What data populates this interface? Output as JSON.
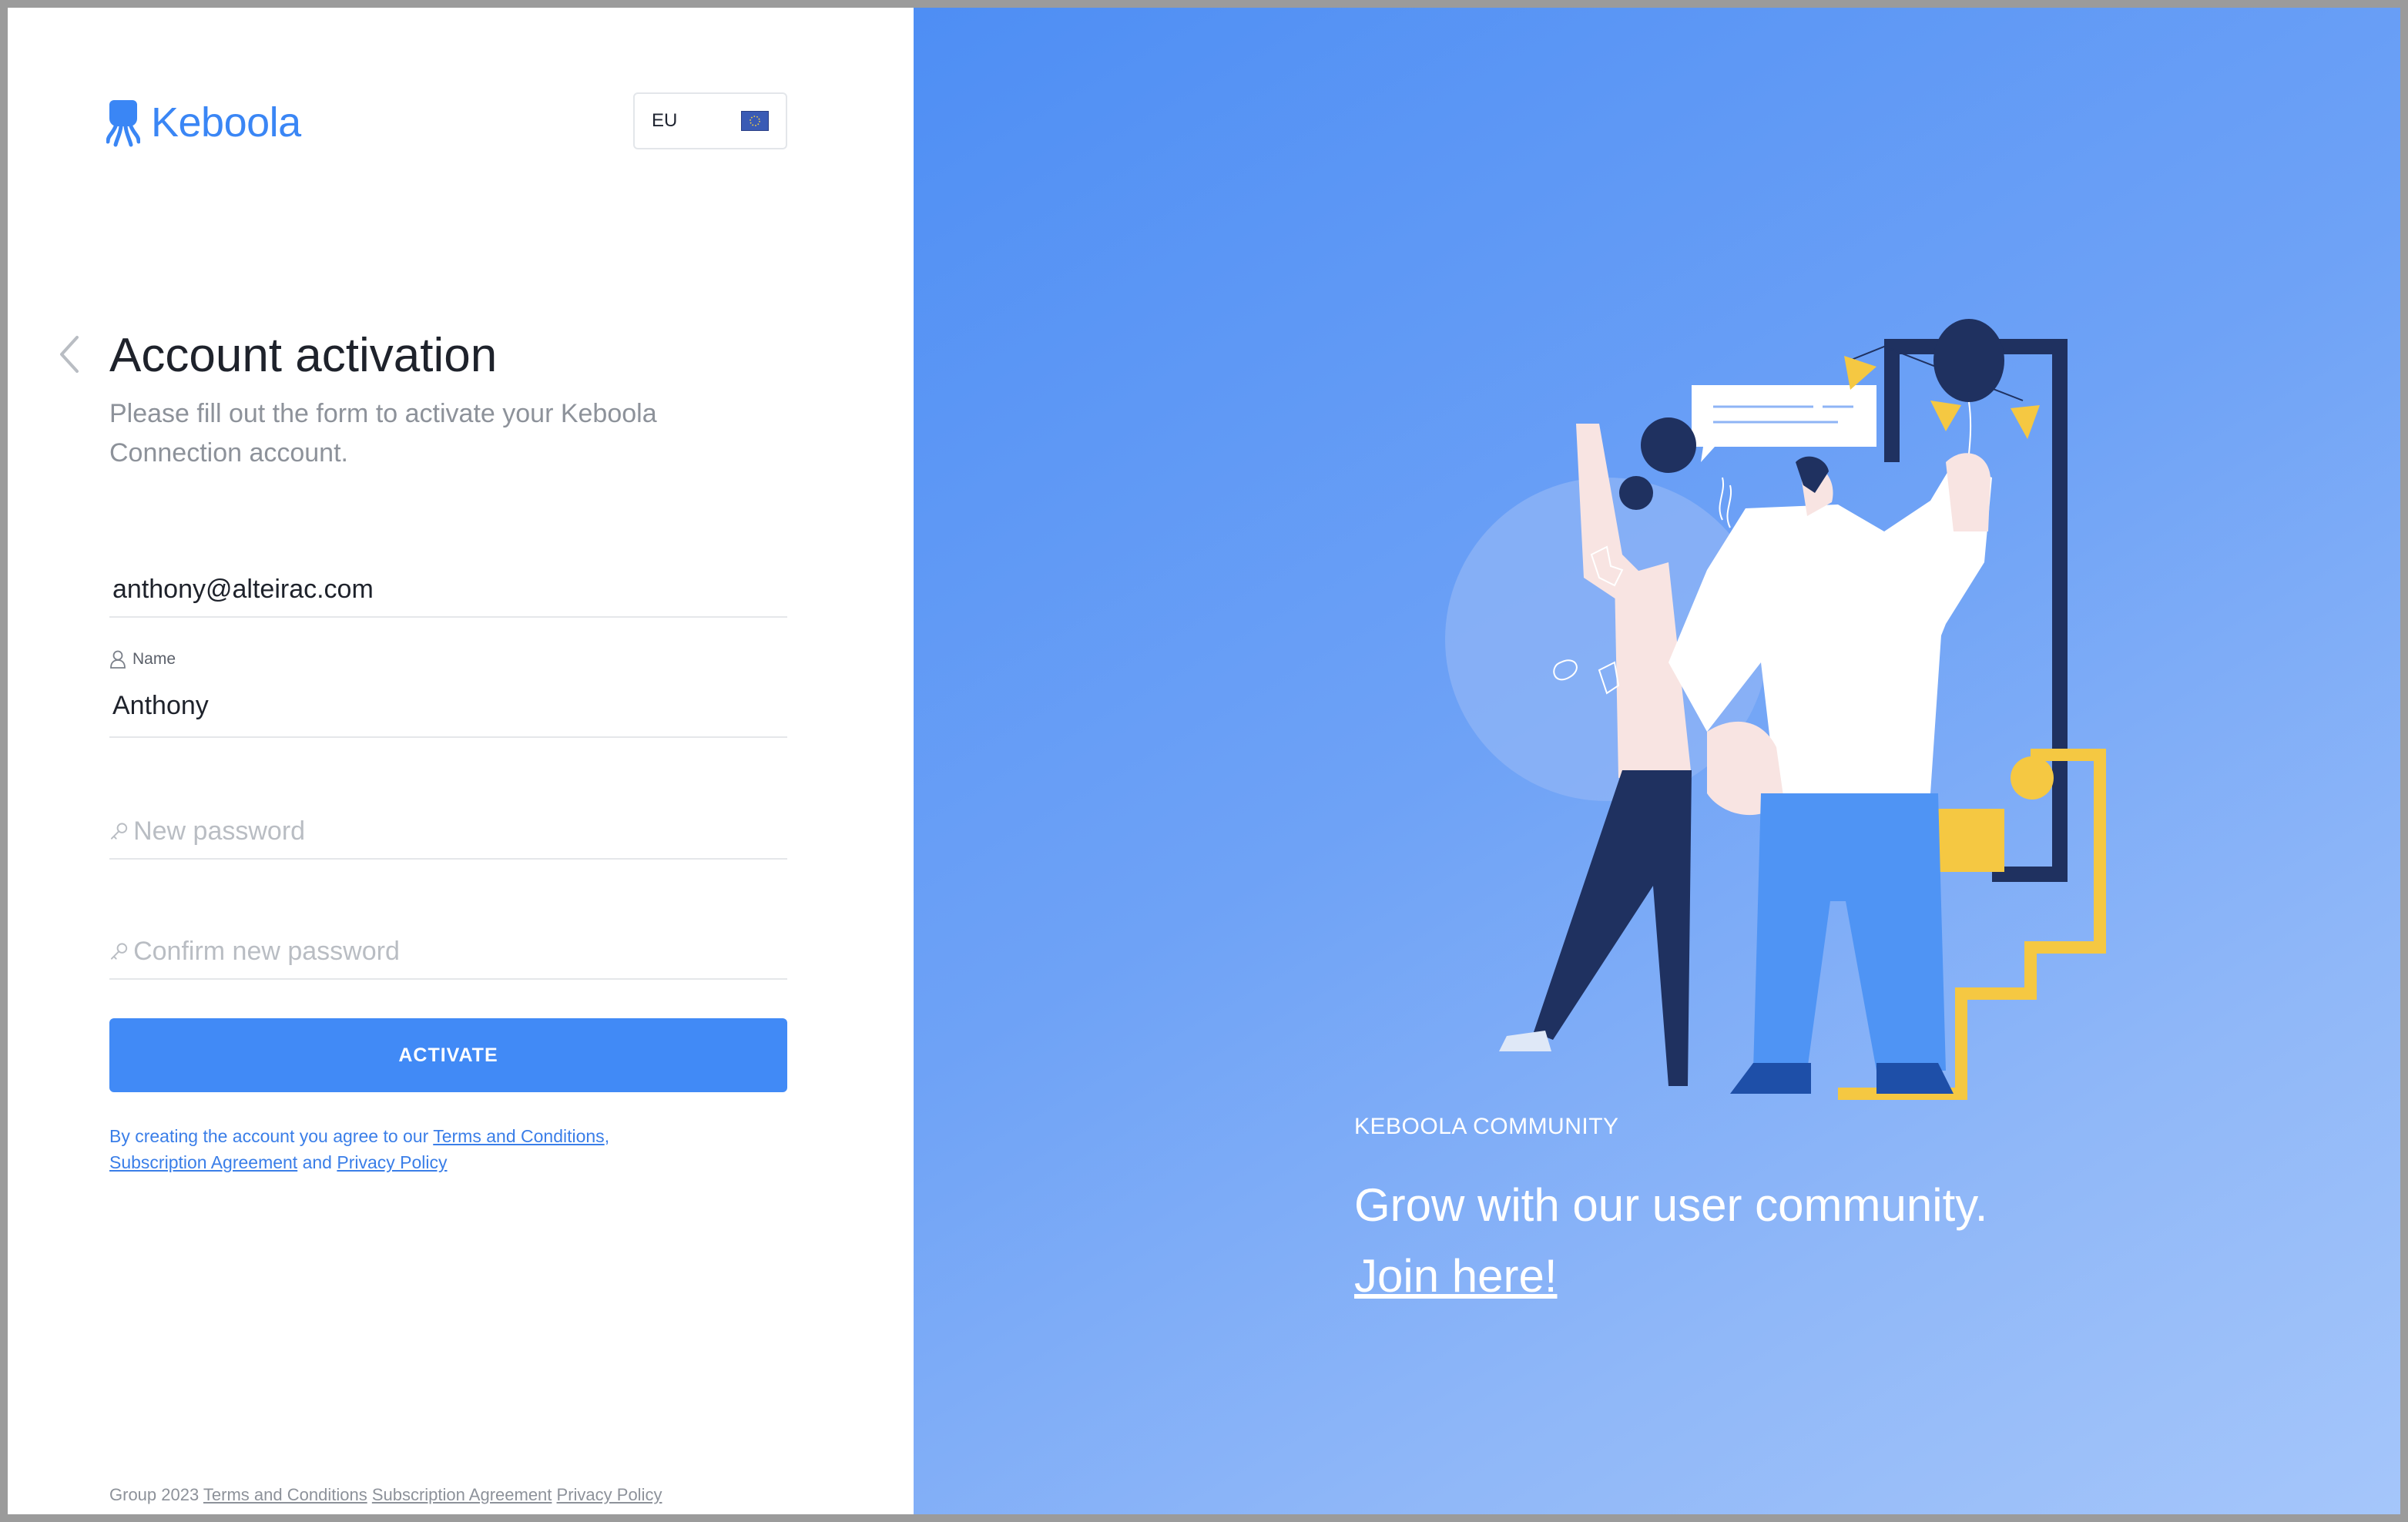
{
  "brand": {
    "name": "Keboola",
    "accent": "#3a86f5"
  },
  "region": {
    "label": "EU",
    "icon": "eu-flag-icon"
  },
  "form": {
    "title": "Account activation",
    "subtitle": "Please fill out the form to activate your Keboola Connection account.",
    "email_value": "anthony@alteirac.com",
    "name_label": "Name",
    "name_value": "Anthony",
    "new_password_placeholder": "New password",
    "confirm_password_placeholder": "Confirm new password",
    "activate_label": "ACTIVATE",
    "agreement": {
      "prefix": "By creating the account you agree to our ",
      "terms": "Terms and Conditions",
      "comma": ",",
      "subscription": "Subscription Agreement",
      "and": " and ",
      "privacy": "Privacy Policy"
    }
  },
  "footer": {
    "text": "Group 2023",
    "terms": "Terms and Conditions",
    "subscription": "Subscription Agreement",
    "privacy": "Privacy Policy"
  },
  "promo": {
    "label": "KEBOOLA COMMUNITY",
    "headline": "Grow with our user community.",
    "link": "Join here!"
  },
  "colors": {
    "button": "#418af6",
    "panel_gradient_start": "#4e8ef4",
    "panel_gradient_end": "#a5c6fa",
    "navy": "#1f3160",
    "yellow": "#f5c842"
  }
}
